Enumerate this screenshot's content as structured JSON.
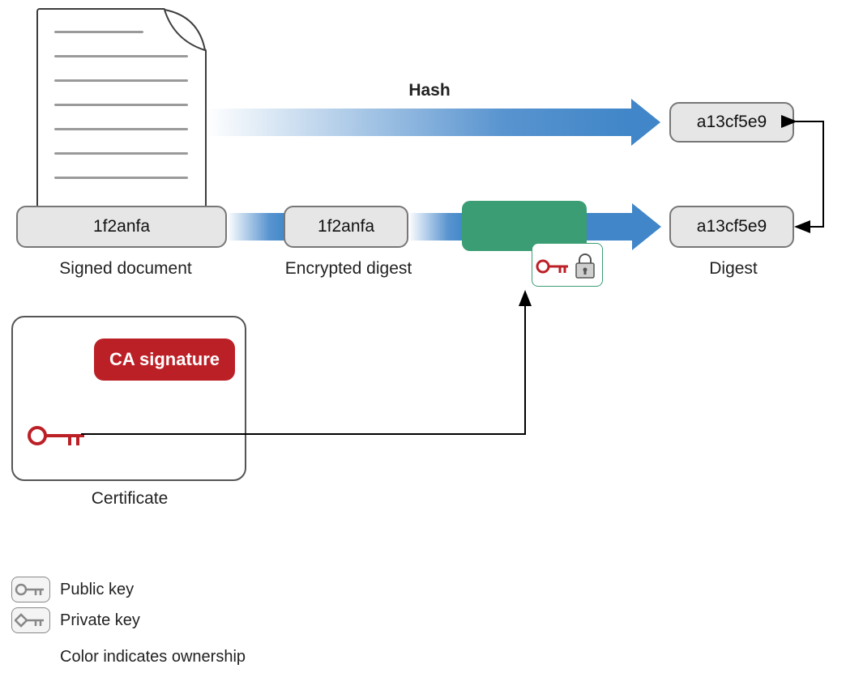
{
  "hash_label": "Hash",
  "signed_doc": {
    "value": "1f2anfa",
    "caption": "Signed document"
  },
  "encrypted_digest": {
    "value": "1f2anfa",
    "caption": "Encrypted digest"
  },
  "digest_top": "a13cf5e9",
  "digest_bottom": "a13cf5e9",
  "digest_caption": "Digest",
  "certificate": {
    "badge": "CA signature",
    "caption": "Certificate"
  },
  "legend": {
    "public": "Public key",
    "private": "Private key",
    "note": "Color indicates ownership"
  },
  "icons": {
    "key_red": "key-icon",
    "key_grey": "key-icon",
    "diamond_key": "private-key-icon",
    "lock": "lock-icon"
  },
  "colors": {
    "blue": "#4086c8",
    "green": "#3b9d73",
    "red": "#bc2027",
    "boxfill": "#e6e6e6",
    "boxborder": "#777777"
  }
}
